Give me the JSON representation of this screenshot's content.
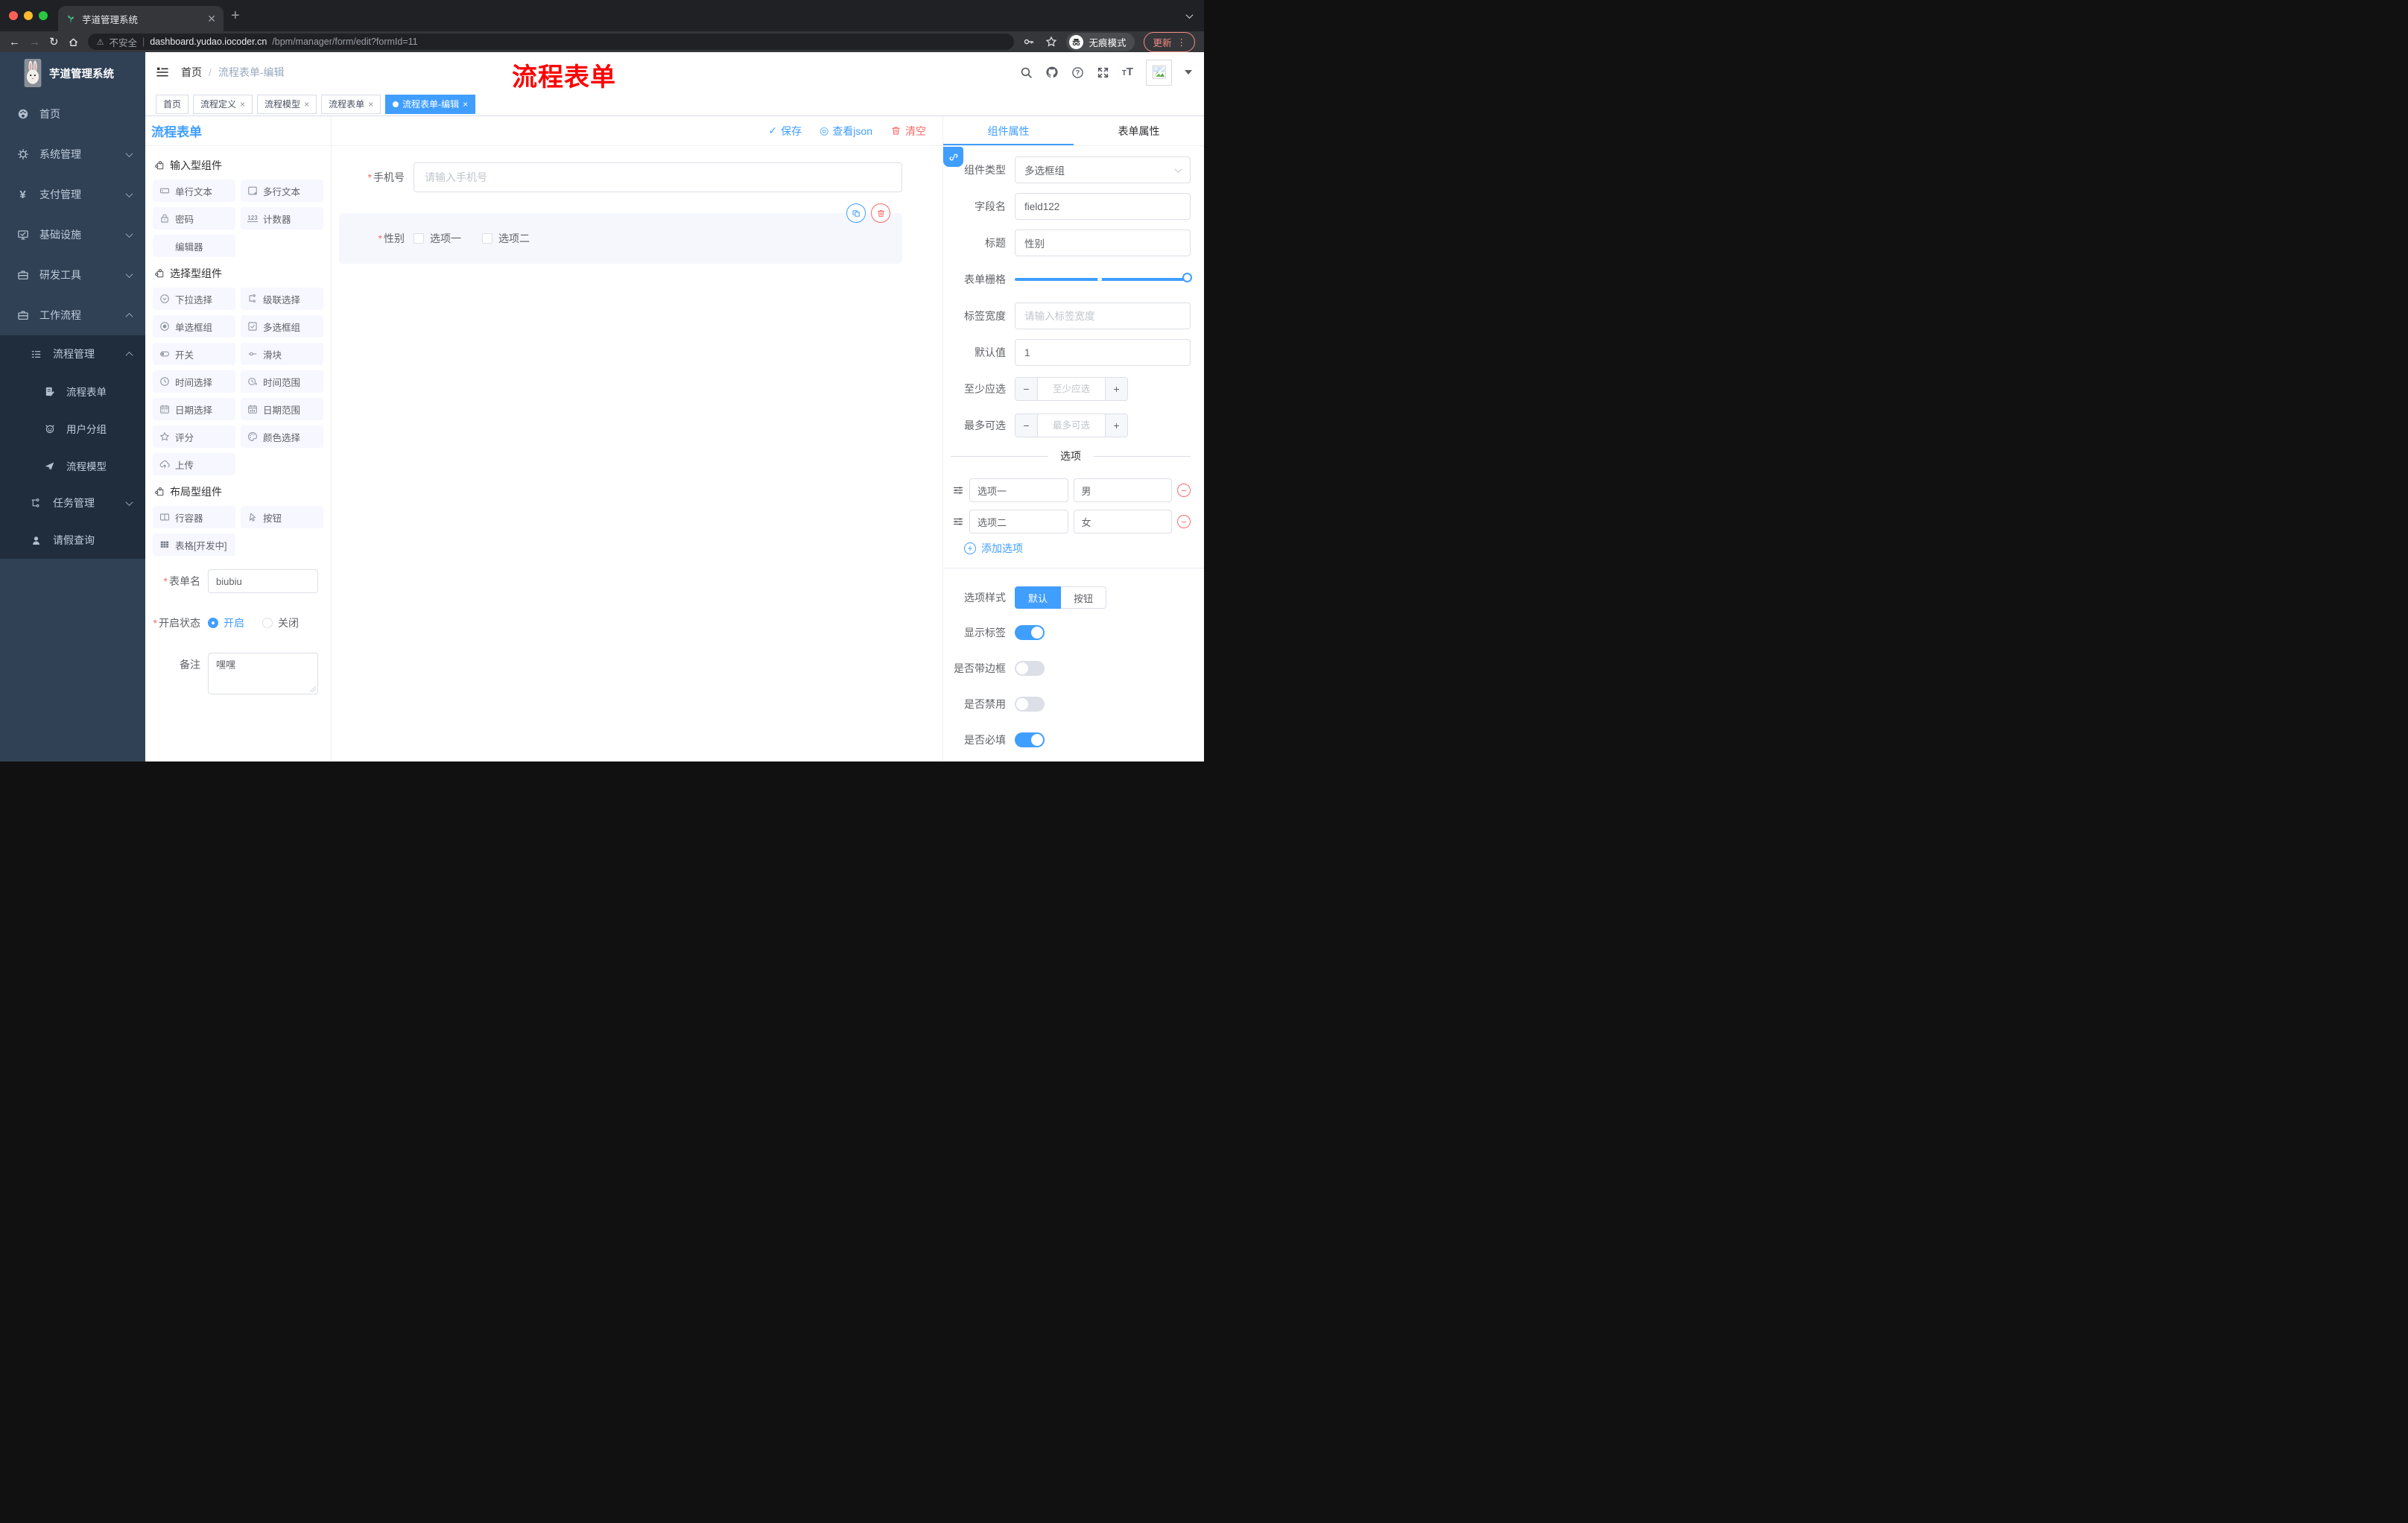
{
  "common": {
    "required_mark": "*",
    "minus": "−",
    "plus": "+"
  },
  "browser": {
    "tab_title": "芋道管理系统",
    "security_label": "不安全",
    "url_domain": "dashboard.yudao.iocoder.cn",
    "url_path": "/bpm/manager/form/edit?formId=11",
    "incognito_label": "无痕模式",
    "update_label": "更新"
  },
  "sidebar": {
    "logo_title": "芋道管理系统",
    "items": [
      {
        "label": "首页",
        "icon": "dashboard-icon"
      },
      {
        "label": "系统管理",
        "icon": "gear-icon"
      },
      {
        "label": "支付管理",
        "icon": "yen-icon"
      },
      {
        "label": "基础设施",
        "icon": "monitor-icon"
      },
      {
        "label": "研发工具",
        "icon": "toolbox-icon"
      },
      {
        "label": "工作流程",
        "icon": "briefcase-icon"
      }
    ],
    "submenu": {
      "manage": "流程管理",
      "children": [
        "流程表单",
        "用户分组",
        "流程模型"
      ],
      "tasks": "任务管理",
      "leave": "请假查询"
    }
  },
  "header": {
    "breadcrumb_home": "首页",
    "breadcrumb_sep": "/",
    "breadcrumb_current": "流程表单-编辑",
    "watermark": "流程表单"
  },
  "tags": {
    "items": [
      "首页",
      "流程定义",
      "流程模型",
      "流程表单",
      "流程表单-编辑"
    ]
  },
  "designer": {
    "panel_title": "流程表单",
    "section_input": "输入型组件",
    "input_items": [
      "单行文本",
      "多行文本",
      "密码",
      "计数器",
      "编辑器"
    ],
    "section_select": "选择型组件",
    "select_items": [
      "下拉选择",
      "级联选择",
      "单选框组",
      "多选框组",
      "开关",
      "滑块",
      "时间选择",
      "时间范围",
      "日期选择",
      "日期范围",
      "评分",
      "颜色选择",
      "上传"
    ],
    "section_layout": "布局型组件",
    "layout_items": [
      "行容器",
      "按钮",
      "表格[开发中]"
    ],
    "meta": {
      "name_label": "表单名",
      "name_value": "biubiu",
      "status_label": "开启状态",
      "status_on": "开启",
      "status_off": "关闭",
      "remark_label": "备注",
      "remark_value": "嘿嘿"
    }
  },
  "canvas": {
    "save": "保存",
    "view_json": "查看json",
    "clear": "清空",
    "phone_label": "手机号",
    "phone_placeholder": "请输入手机号",
    "gender_label": "性别",
    "gender_options": [
      "选项一",
      "选项二"
    ]
  },
  "props": {
    "tab_component": "组件属性",
    "tab_form": "表单属性",
    "type_label": "组件类型",
    "type_value": "多选框组",
    "field_label": "字段名",
    "field_value": "field122",
    "title_label": "标题",
    "title_value": "性别",
    "grid_label": "表单栅格",
    "width_label": "标签宽度",
    "width_placeholder": "请输入标签宽度",
    "default_label": "默认值",
    "default_value": "1",
    "min_label": "至少应选",
    "min_placeholder": "至少应选",
    "max_label": "最多可选",
    "max_placeholder": "最多可选",
    "options_divider": "选项",
    "option_rows": [
      {
        "name": "选项一",
        "value": "男"
      },
      {
        "name": "选项二",
        "value": "女"
      }
    ],
    "add_option": "添加选项",
    "style_label": "选项样式",
    "style_default": "默认",
    "style_button": "按钮",
    "switch_show_label": "显示标签",
    "switch_border": "是否带边框",
    "switch_disabled": "是否禁用",
    "switch_required": "是否必填"
  },
  "colors": {
    "accent": "#409eff",
    "danger": "#f56c6c",
    "watermark_red": "#ff0000",
    "sidebar_bg": "#304156",
    "submenu_bg": "#1f2d3d",
    "selected_block_bg": "#f6f7fc"
  }
}
